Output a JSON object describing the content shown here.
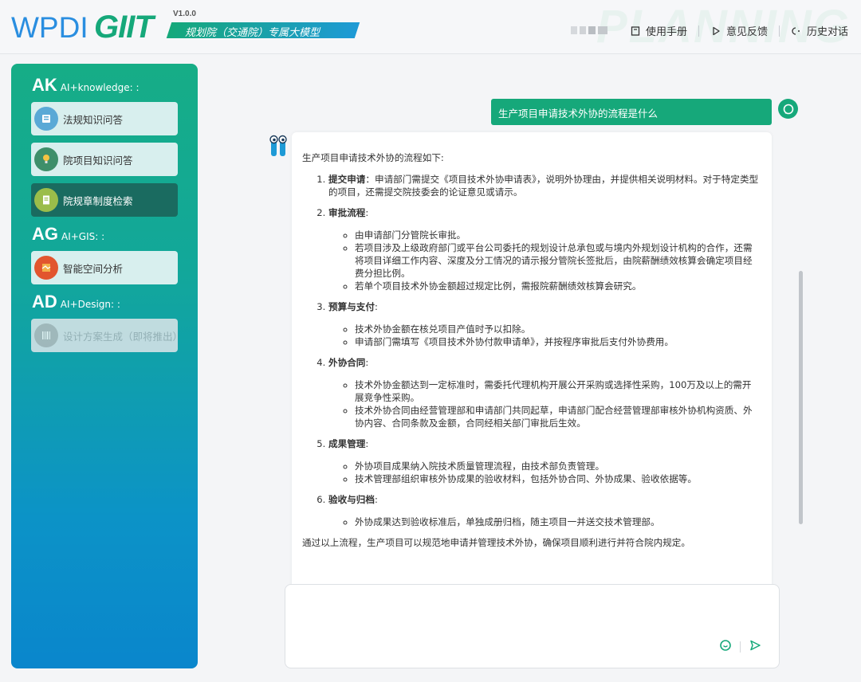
{
  "header": {
    "logo_main": "WPDI",
    "logo_git": "GIIT",
    "version": "V1.0.0",
    "subtitle": "规划院（交通院）专属大模型",
    "watermark": "PLANNING",
    "nav": {
      "manual": "使用手册",
      "feedback": "意见反馈",
      "history": "历史对话"
    }
  },
  "sidebar": {
    "sections": [
      {
        "code": "AK",
        "label": "AI+knowledge: :"
      },
      {
        "code": "AG",
        "label": "AI+GIS: :"
      },
      {
        "code": "AD",
        "label": "AI+Design: :"
      }
    ],
    "items": [
      {
        "label": "法规知识问答",
        "state": "normal",
        "icon": "law-book-icon"
      },
      {
        "label": "院项目知识问答",
        "state": "normal",
        "icon": "lightbulb-icon"
      },
      {
        "label": "院规章制度检索",
        "state": "active",
        "icon": "document-search-icon"
      },
      {
        "label": "智能空间分析",
        "state": "normal",
        "icon": "map-analysis-icon"
      },
      {
        "label": "设计方案生成（即将推出）",
        "state": "disabled",
        "icon": "barcode-icon"
      }
    ]
  },
  "chat": {
    "question": "生产项目申请技术外协的流程是什么",
    "answer": {
      "intro": "生产项目申请技术外协的流程如下:",
      "steps": [
        {
          "title": "提交申请",
          "text": "：申请部门需提交《项目技术外协申请表》，说明外协理由，并提供相关说明材料。对于特定类型的项目，还需提交院技委会的论证意见或请示。",
          "bullets": []
        },
        {
          "title": "审批流程",
          "text": ":",
          "bullets": [
            "由申请部门分管院长审批。",
            "若项目涉及上级政府部门或平台公司委托的规划设计总承包或与境内外规划设计机构的合作，还需将项目详细工作内容、深度及分工情况的请示报分管院长签批后，由院薪酬绩效核算会确定项目经费分担比例。",
            "若单个项目技术外协金额超过规定比例，需报院薪酬绩效核算会研究。"
          ]
        },
        {
          "title": "预算与支付",
          "text": ":",
          "bullets": [
            "技术外协金额在核兑项目产值时予以扣除。",
            "申请部门需填写《项目技术外协付款申请单》，并按程序审批后支付外协费用。"
          ]
        },
        {
          "title": "外协合同",
          "text": ":",
          "bullets": [
            "技术外协金额达到一定标准时，需委托代理机构开展公开采购或选择性采购，100万及以上的需开展竞争性采购。",
            "技术外协合同由经营管理部和申请部门共同起草，申请部门配合经营管理部审核外协机构资质、外协内容、合同条款及金额，合同经相关部门审批后生效。"
          ]
        },
        {
          "title": "成果管理",
          "text": ":",
          "bullets": [
            "外协项目成果纳入院技术质量管理流程，由技术部负责管理。",
            "技术管理部组织审核外协成果的验收材料，包括外协合同、外协成果、验收依据等。"
          ]
        },
        {
          "title": "验收与归档",
          "text": ":",
          "bullets": [
            "外协成果达到验收标准后，单独成册归档，随主项目一并送交技术管理部。"
          ]
        }
      ],
      "outro": "通过以上流程，生产项目可以规范地申请并管理技术外协，确保项目顺利进行并符合院内规定。"
    }
  },
  "input": {
    "placeholder": "",
    "value": ""
  },
  "colors": {
    "brand_green": "#16a87a",
    "brand_blue": "#2a8ee0",
    "active_item": "#1a6b60"
  }
}
